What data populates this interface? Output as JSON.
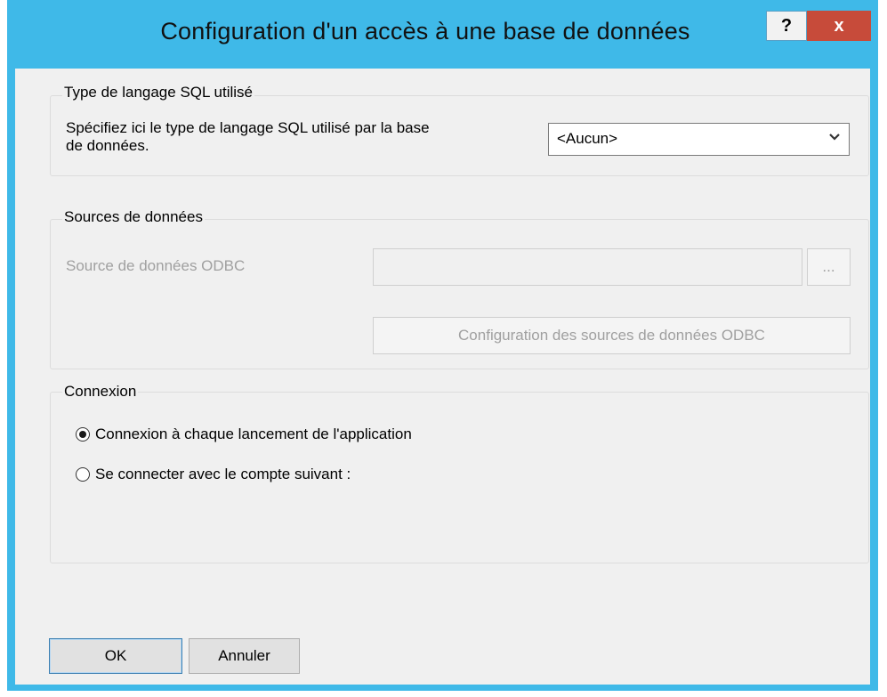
{
  "window": {
    "title": "Configuration d'un accès à une base de données",
    "help_label": "?",
    "close_label": "x"
  },
  "sql_group": {
    "title": "Type de langage SQL utilisé",
    "description_line1": "Spécifiez ici le type de langage SQL utilisé par la base",
    "description_line2": "de données.",
    "select_value": "<Aucun>",
    "select_icon": "chevron-down-icon"
  },
  "sources_group": {
    "title": "Sources de données",
    "odbc_label": "Source de données ODBC",
    "odbc_value": "",
    "browse_label": "...",
    "config_button_label": "Configuration des sources de données ODBC",
    "enabled": false
  },
  "connexion_group": {
    "title": "Connexion",
    "options": [
      {
        "label": "Connexion à chaque lancement de l'application",
        "selected": true
      },
      {
        "label": "Se connecter avec le compte suivant :",
        "selected": false
      }
    ]
  },
  "footer": {
    "ok_label": "OK",
    "cancel_label": "Annuler"
  },
  "colors": {
    "titlebar": "#3fb9e8",
    "close_button": "#c74b3a",
    "client_background": "#f0f0f0",
    "disabled_text": "#a0a0a0"
  }
}
